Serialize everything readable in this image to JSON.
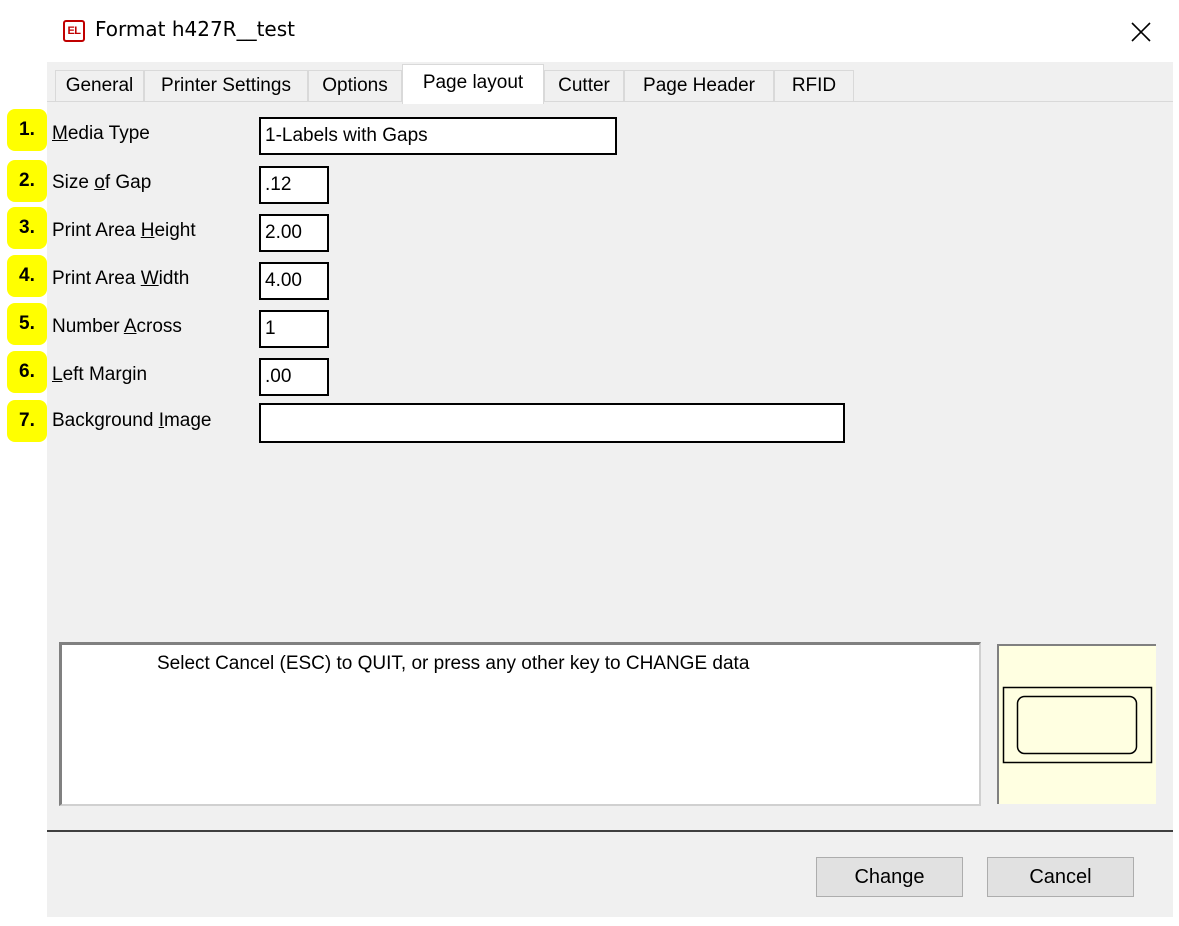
{
  "window": {
    "icon_name": "easylabel-app-icon",
    "icon_text": "EL",
    "title": "Format h427R__test",
    "close_icon": "close-icon"
  },
  "tabs": [
    {
      "label": "General",
      "active": false
    },
    {
      "label": "Printer Settings",
      "active": false
    },
    {
      "label": "Options",
      "active": false
    },
    {
      "label": "Page layout",
      "active": true
    },
    {
      "label": "Cutter",
      "active": false
    },
    {
      "label": "Page Header",
      "active": false
    },
    {
      "label": "RFID",
      "active": false
    }
  ],
  "badges": [
    "1.",
    "2.",
    "3.",
    "4.",
    "5.",
    "6.",
    "7."
  ],
  "fields": [
    {
      "label_pre": "",
      "label_u": "M",
      "label_post": "edia Type",
      "value": "1-Labels with Gaps"
    },
    {
      "label_pre": "Size ",
      "label_u": "o",
      "label_post": "f Gap",
      "value": ".12"
    },
    {
      "label_pre": "Print Area ",
      "label_u": "H",
      "label_post": "eight",
      "value": "2.00"
    },
    {
      "label_pre": "Print Area ",
      "label_u": "W",
      "label_post": "idth",
      "value": "4.00"
    },
    {
      "label_pre": "Number ",
      "label_u": "A",
      "label_post": "cross",
      "value": "1"
    },
    {
      "label_pre": "",
      "label_u": "L",
      "label_post": "eft Margin",
      "value": ".00"
    },
    {
      "label_pre": "Background ",
      "label_u": "I",
      "label_post": "mage",
      "value": ""
    }
  ],
  "message": "Select Cancel (ESC) to QUIT, or press any other key to CHANGE data",
  "preview": {
    "icon": "label-preview-icon",
    "background": "#ffffe1"
  },
  "buttons": {
    "change": "Change",
    "cancel": "Cancel"
  },
  "colors": {
    "badge": "#ffff00",
    "app_icon": "#c00000"
  }
}
